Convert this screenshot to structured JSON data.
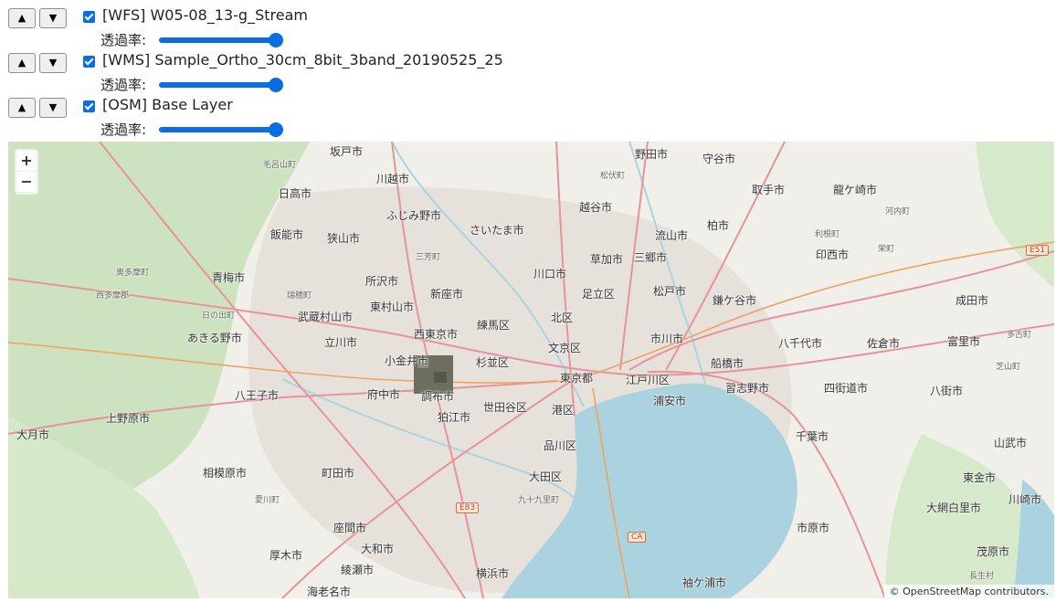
{
  "layers": [
    {
      "name": "[WFS] W05-08_13-g_Stream",
      "up_label": "▲",
      "down_label": "▼",
      "checked": true,
      "opacity_label": "透過率:",
      "opacity": 1.0
    },
    {
      "name": "[WMS] Sample_Ortho_30cm_8bit_3band_20190525_25",
      "up_label": "▲",
      "down_label": "▼",
      "checked": true,
      "opacity_label": "透過率:",
      "opacity": 1.0
    },
    {
      "name": "[OSM] Base Layer",
      "up_label": "▲",
      "down_label": "▼",
      "checked": true,
      "opacity_label": "透過率:",
      "opacity": 1.0
    }
  ],
  "map": {
    "zoom_in": "+",
    "zoom_out": "−",
    "attribution": "© OpenStreetMap contributors.",
    "colors": {
      "land": "#f1efe9",
      "forest": "#cde3c0",
      "water": "#aad3df",
      "urban": "#e6e0db",
      "road": "#e8929a"
    },
    "places": [
      {
        "name": "坂戸市",
        "big": true
      },
      {
        "name": "川越市",
        "big": true
      },
      {
        "name": "野田市",
        "big": true
      },
      {
        "name": "守谷市",
        "big": true
      },
      {
        "name": "毛呂山町",
        "big": false
      },
      {
        "name": "松伏町",
        "big": false
      },
      {
        "name": "日高市",
        "big": true
      },
      {
        "name": "ふじみ野市",
        "big": true
      },
      {
        "name": "越谷市",
        "big": true
      },
      {
        "name": "取手市",
        "big": true
      },
      {
        "name": "龍ケ崎市",
        "big": true
      },
      {
        "name": "さいたま市",
        "big": true
      },
      {
        "name": "流山市",
        "big": true
      },
      {
        "name": "柏市",
        "big": true
      },
      {
        "name": "河内町",
        "big": false
      },
      {
        "name": "飯能市",
        "big": true
      },
      {
        "name": "狭山市",
        "big": true
      },
      {
        "name": "三芳町",
        "big": false
      },
      {
        "name": "草加市",
        "big": true
      },
      {
        "name": "三郷市",
        "big": true
      },
      {
        "name": "利根町",
        "big": false
      },
      {
        "name": "印西市",
        "big": true
      },
      {
        "name": "栄町",
        "big": false
      },
      {
        "name": "E51",
        "big": false
      },
      {
        "name": "奥多摩町",
        "big": false
      },
      {
        "name": "青梅市",
        "big": true
      },
      {
        "name": "所沢市",
        "big": true
      },
      {
        "name": "川口市",
        "big": true
      },
      {
        "name": "西多摩郡",
        "big": false
      },
      {
        "name": "瑞穂町",
        "big": false
      },
      {
        "name": "新座市",
        "big": true
      },
      {
        "name": "足立区",
        "big": true
      },
      {
        "name": "松戸市",
        "big": true
      },
      {
        "name": "鎌ケ谷市",
        "big": true
      },
      {
        "name": "成田市",
        "big": true
      },
      {
        "name": "東村山市",
        "big": true
      },
      {
        "name": "日の出町",
        "big": false
      },
      {
        "name": "武蔵村山市",
        "big": true
      },
      {
        "name": "北区",
        "big": true
      },
      {
        "name": "練馬区",
        "big": true
      },
      {
        "name": "西東京市",
        "big": true
      },
      {
        "name": "市川市",
        "big": true
      },
      {
        "name": "八千代市",
        "big": true
      },
      {
        "name": "佐倉市",
        "big": true
      },
      {
        "name": "富里市",
        "big": true
      },
      {
        "name": "多古町",
        "big": false
      },
      {
        "name": "あきる野市",
        "big": true
      },
      {
        "name": "立川市",
        "big": true
      },
      {
        "name": "文京区",
        "big": true
      },
      {
        "name": "小金井市",
        "big": true
      },
      {
        "name": "杉並区",
        "big": true
      },
      {
        "name": "船橋市",
        "big": true
      },
      {
        "name": "芝山町",
        "big": false
      },
      {
        "name": "東京都",
        "big": true
      },
      {
        "name": "江戸川区",
        "big": true
      },
      {
        "name": "八王子市",
        "big": true
      },
      {
        "name": "府中市",
        "big": true
      },
      {
        "name": "調布市",
        "big": true
      },
      {
        "name": "習志野市",
        "big": true
      },
      {
        "name": "四街道市",
        "big": true
      },
      {
        "name": "八街市",
        "big": true
      },
      {
        "name": "世田谷区",
        "big": true
      },
      {
        "name": "港区",
        "big": true
      },
      {
        "name": "浦安市",
        "big": true
      },
      {
        "name": "上野原市",
        "big": true
      },
      {
        "name": "狛江市",
        "big": true
      },
      {
        "name": "大月市",
        "big": true
      },
      {
        "name": "千葉市",
        "big": true
      },
      {
        "name": "山武市",
        "big": true
      },
      {
        "name": "品川区",
        "big": true
      },
      {
        "name": "相模原市",
        "big": true
      },
      {
        "name": "町田市",
        "big": true
      },
      {
        "name": "大田区",
        "big": true
      },
      {
        "name": "東金市",
        "big": true
      },
      {
        "name": "愛川町",
        "big": false
      },
      {
        "name": "E83",
        "big": false
      },
      {
        "name": "川崎市",
        "big": true
      },
      {
        "name": "九十九里町",
        "big": false
      },
      {
        "name": "大網白里市",
        "big": true
      },
      {
        "name": "座間市",
        "big": true
      },
      {
        "name": "市原市",
        "big": true
      },
      {
        "name": "CA",
        "big": false
      },
      {
        "name": "大和市",
        "big": true
      },
      {
        "name": "厚木市",
        "big": true
      },
      {
        "name": "茂原市",
        "big": true
      },
      {
        "name": "綾瀬市",
        "big": true
      },
      {
        "name": "横浜市",
        "big": true
      },
      {
        "name": "長生村",
        "big": false
      },
      {
        "name": "袖ケ浦市",
        "big": true
      },
      {
        "name": "海老名市",
        "big": true
      }
    ]
  }
}
